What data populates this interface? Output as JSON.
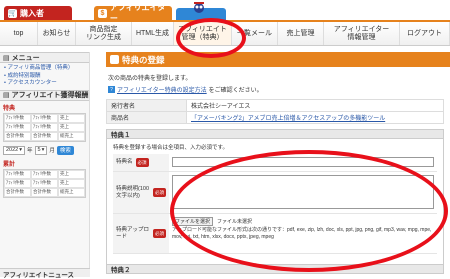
{
  "tabs": {
    "buyer": "購入者",
    "affiliator": "アフィリエイター"
  },
  "nav": [
    "top",
    "お知らせ",
    "商品指定\nリンク生成",
    "HTML生成",
    "アフィリエイト\n管理（特典）",
    "一覧メール",
    "売上管理",
    "アフィリエイター\n情報管理",
    "ログアウト"
  ],
  "sidebar": {
    "menu_title": "メニュー",
    "links": [
      "アフィリ商品管理（特典）",
      "成約特別報酬",
      "アクセスカウンター"
    ],
    "earnings_title": "アフィリエイト獲得報酬",
    "earnings_sub": "特典",
    "grid1": [
      "ｱﾌｨﾘ件数",
      "ｱﾌｨﾘ件数",
      "売上",
      "ｱﾌｨﾘ件数",
      "ｱﾌｨﾘ件数",
      "売上",
      "合計件数",
      "合計件数",
      "総売上"
    ],
    "year": "2022",
    "year_suffix": "年",
    "month": "5",
    "month_suffix": "月",
    "view_button": "検索",
    "total_sub": "累計",
    "grid2": [
      "ｱﾌｨﾘ件数",
      "ｱﾌｨﾘ件数",
      "売上",
      "ｱﾌｨﾘ件数",
      "ｱﾌｨﾘ件数",
      "売上",
      "合計件数",
      "合計件数",
      "総売上"
    ],
    "news_title": "アフィリエイトニュース"
  },
  "main": {
    "title": "特典の登録",
    "intro": "次の商品の特典を登録します。",
    "howto_link": "アフィリエイター特典の設定方法",
    "howto_suffix": "をご確認ください。",
    "info": [
      {
        "label": "発行者名",
        "value": "株式会社シーアイエス"
      },
      {
        "label": "商品名",
        "value": "「アメーバキング2」アメブロ売上倍増＆アクセスアップの多機能ツール"
      }
    ],
    "section1": "特典１",
    "section1_note": "特典を登録する場合は全項目、入力必須です。",
    "fields": [
      {
        "label": "特典名",
        "required": "必須"
      },
      {
        "label": "特典説明(100文字以内)",
        "required": "必須"
      },
      {
        "label": "特典アップロード",
        "required": "必須"
      }
    ],
    "file_button": "ファイルを選択",
    "file_status": "ファイル未選択",
    "file_note": "アップロード可能なファイル形式は次の通りです：pdf, exe, zip, lzh, doc, xls, ppt, jpg, png, gif, mp3, wav, mpg, mpe, mov, avi, txt, htm, xlsx, docx, pptx, jpeg, mpeg",
    "section2": "特典２"
  },
  "colors": {
    "accent": "#e6821d",
    "buyer": "#c3241f",
    "highlight": "#e8101a",
    "link": "#2a58a8"
  }
}
